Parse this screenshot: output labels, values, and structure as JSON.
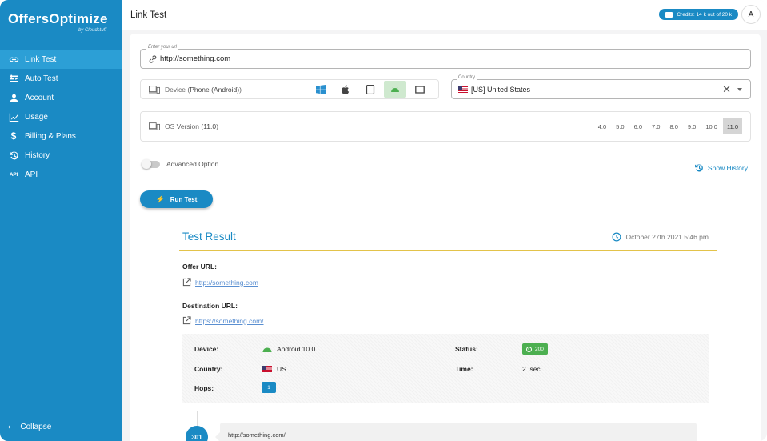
{
  "app": {
    "logo_title": "OffersOptimize",
    "logo_sub": "by Cloudstuff"
  },
  "sidebar": {
    "items": [
      {
        "label": "Link Test",
        "icon": "link-icon",
        "active": true
      },
      {
        "label": "Auto Test",
        "icon": "auto-test-icon",
        "active": false
      },
      {
        "label": "Account",
        "icon": "account-icon",
        "active": false
      },
      {
        "label": "Usage",
        "icon": "usage-chart-icon",
        "active": false
      },
      {
        "label": "Billing & Plans",
        "icon": "dollar-icon",
        "active": false
      },
      {
        "label": "History",
        "icon": "history-icon",
        "active": false
      },
      {
        "label": "API",
        "icon": "api-icon",
        "active": false
      }
    ],
    "collapse_label": "Collapse"
  },
  "header": {
    "title": "Link Test",
    "credits_label": "Credits: 14 k out of 20 k",
    "avatar_initial": "A"
  },
  "form": {
    "url_legend": "Enter your url",
    "url_value": "http://something.com",
    "device_prefix": "Device (",
    "device_value": "Phone (Android)",
    "device_suffix": ")",
    "device_options": [
      "windows",
      "apple",
      "tablet",
      "android",
      "desktop"
    ],
    "device_selected": "android",
    "country_legend": "Country",
    "country_value": "[US] United States",
    "os_prefix": "OS Version (",
    "os_value": "11.0",
    "os_suffix": ")",
    "os_versions": [
      "4.0",
      "5.0",
      "6.0",
      "7.0",
      "8.0",
      "9.0",
      "10.0",
      "11.0"
    ],
    "os_selected": "11.0",
    "advanced_label": "Advanced Option",
    "show_history_label": "Show History",
    "run_label": "Run Test"
  },
  "result": {
    "title": "Test Result",
    "timestamp": "October 27th 2021 5:46 pm",
    "offer_label": "Offer URL:",
    "offer_url": "http://something.com",
    "destination_label": "Destination URL:",
    "destination_url": "https://something.com/",
    "device_label": "Device:",
    "device_value": "Android 10.0",
    "country_label": "Country:",
    "country_value": "US",
    "hops_label": "Hops:",
    "hops_value": "1",
    "status_label": "Status:",
    "status_value": "200",
    "time_label": "Time:",
    "time_value": "2 .sec",
    "hop_code": "301",
    "hop_url": "http://something.com/"
  },
  "colors": {
    "primary": "#1a8ac4",
    "accent_line": "#e3c34a",
    "success": "#4caf50",
    "link": "#5a8fd1"
  }
}
